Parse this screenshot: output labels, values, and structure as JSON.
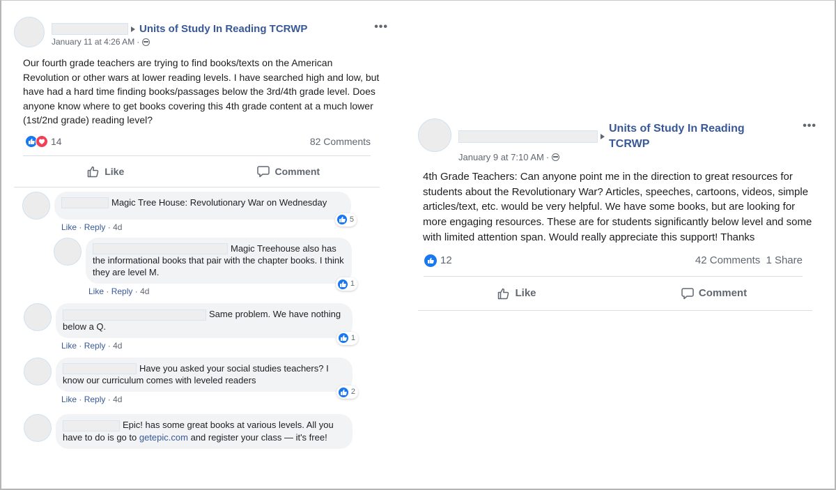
{
  "posts": [
    {
      "group_name": "Units of Study In Reading TCRWP",
      "timestamp": "January 11 at 4:26 AM",
      "privacy_icon": "globe-icon",
      "body": "Our fourth grade teachers are trying to find books/texts on the American Revolution or other wars at lower reading levels. I have searched high and low, but have had a hard time finding books/passages below the 3rd/4th grade level. Does anyone know where to get books covering this 4th grade content at a much lower (1st/2nd grade) reading level?",
      "reaction_count": "14",
      "reaction_icons": [
        "like-reaction-icon",
        "love-reaction-icon"
      ],
      "comments_count": "82 Comments",
      "actions": {
        "like": "Like",
        "comment": "Comment"
      },
      "comments": [
        {
          "text": "Magic Tree House: Revolutionary War on Wednesday",
          "like": "Like",
          "reply": "Reply",
          "age": "4d",
          "reactions": "5",
          "replies": [
            {
              "text": "Magic Treehouse also has the informational books that pair with the chapter books. I think they are level M.",
              "like": "Like",
              "reply": "Reply",
              "age": "4d",
              "reactions": "1"
            }
          ]
        },
        {
          "text": "Same problem. We have nothing below a Q.",
          "like": "Like",
          "reply": "Reply",
          "age": "4d",
          "reactions": "1"
        },
        {
          "text": "Have you asked your social studies teachers? I know our curriculum comes with leveled readers",
          "like": "Like",
          "reply": "Reply",
          "age": "4d",
          "reactions": "2"
        },
        {
          "text_before": "Epic! has some great books at various levels. All you have to do is go to ",
          "link": "getepic.com",
          "text_after": " and register your class — it's free!"
        }
      ]
    },
    {
      "group_name": "Units of Study In Reading TCRWP",
      "timestamp": "January 9 at 7:10 AM",
      "privacy_icon": "globe-icon",
      "body": "4th Grade Teachers: Can anyone point me in the direction to great resources for students about the Revolutionary War? Articles, speeches, cartoons, videos, simple articles/text, etc. would be very helpful. We have some books, but are looking for more engaging resources. These are for students significantly below level and some with limited attention span. Would really appreciate this support! Thanks",
      "reaction_count": "12",
      "reaction_icons": [
        "like-reaction-icon"
      ],
      "comments_count": "42 Comments",
      "shares_count": "1 Share",
      "actions": {
        "like": "Like",
        "comment": "Comment"
      }
    }
  ],
  "separators": {
    "dot": "·"
  },
  "menu_glyph": "•••"
}
